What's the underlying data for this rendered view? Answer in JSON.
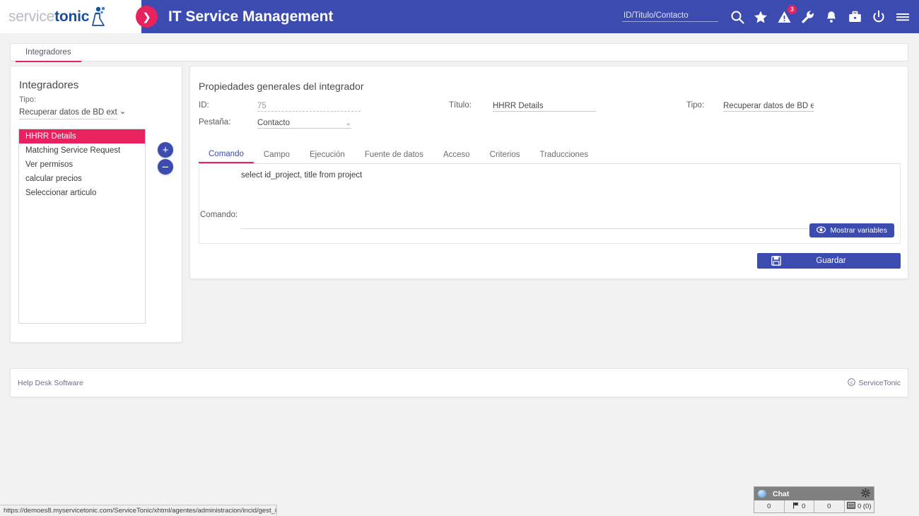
{
  "header": {
    "logo_service": "service",
    "logo_tonic": "tonic",
    "app_title": "IT Service Management",
    "search_placeholder": "ID/Titulo/Contacto",
    "search_value": "",
    "alert_badge": "3",
    "icons": [
      {
        "name": "search-icon",
        "label": "search"
      },
      {
        "name": "star-icon",
        "label": "favorites"
      },
      {
        "name": "warning-triangle-icon",
        "label": "alerts"
      },
      {
        "name": "wrench-icon",
        "label": "tools"
      },
      {
        "name": "bell-icon",
        "label": "notifications"
      },
      {
        "name": "briefcase-icon",
        "label": "briefcase"
      },
      {
        "name": "power-icon",
        "label": "logout"
      },
      {
        "name": "hamburger-menu-icon",
        "label": "menu"
      }
    ],
    "accent_blue": "#3c4bb0",
    "accent_pink": "#e8225e"
  },
  "page_tab": {
    "label": "Integradores"
  },
  "sidebar": {
    "title": "Integradores",
    "tipo_label": "Tipo:",
    "tipo_value": "Recuperar datos de BD ext",
    "items": [
      {
        "label": "HHRR Details",
        "selected": true
      },
      {
        "label": "Matching Service Request",
        "selected": false
      },
      {
        "label": "Ver permisos",
        "selected": false
      },
      {
        "label": "calcular precios",
        "selected": false
      },
      {
        "label": "Seleccionar articulo",
        "selected": false
      }
    ],
    "add_button": "+",
    "remove_button": "−"
  },
  "main": {
    "title": "Propiedades generales del integrador",
    "fields": {
      "id_label": "ID:",
      "id_value": "75",
      "titulo_label": "Título:",
      "titulo_value": "HHRR Details",
      "tipo_label": "Tipo:",
      "tipo_value": "Recuperar datos de BD ext",
      "pestana_label": "Pestaña:",
      "pestana_value": "Contacto"
    },
    "tabs": [
      {
        "label": "Comando",
        "active": true
      },
      {
        "label": "Campo",
        "active": false
      },
      {
        "label": "Ejecución",
        "active": false
      },
      {
        "label": "Fuente de datos",
        "active": false
      },
      {
        "label": "Acceso",
        "active": false
      },
      {
        "label": "Criterios",
        "active": false
      },
      {
        "label": "Traducciones",
        "active": false
      }
    ],
    "command": {
      "label": "Comando:",
      "value": "select id_project, title from project"
    },
    "show_vars_button": "Mostrar variables",
    "save_button": "Guardar"
  },
  "footer": {
    "left_link": "Help Desk Software",
    "right_text": "ServiceTonic"
  },
  "chat": {
    "title": "Chat",
    "cells": [
      "0",
      "0",
      "0",
      "0 (0)"
    ]
  },
  "statusbar": {
    "url": "https://demoes8.myservicetonic.com/ServiceTonic/xhtml/agentes/administracion/incid/gest_integradores.jsf#"
  }
}
